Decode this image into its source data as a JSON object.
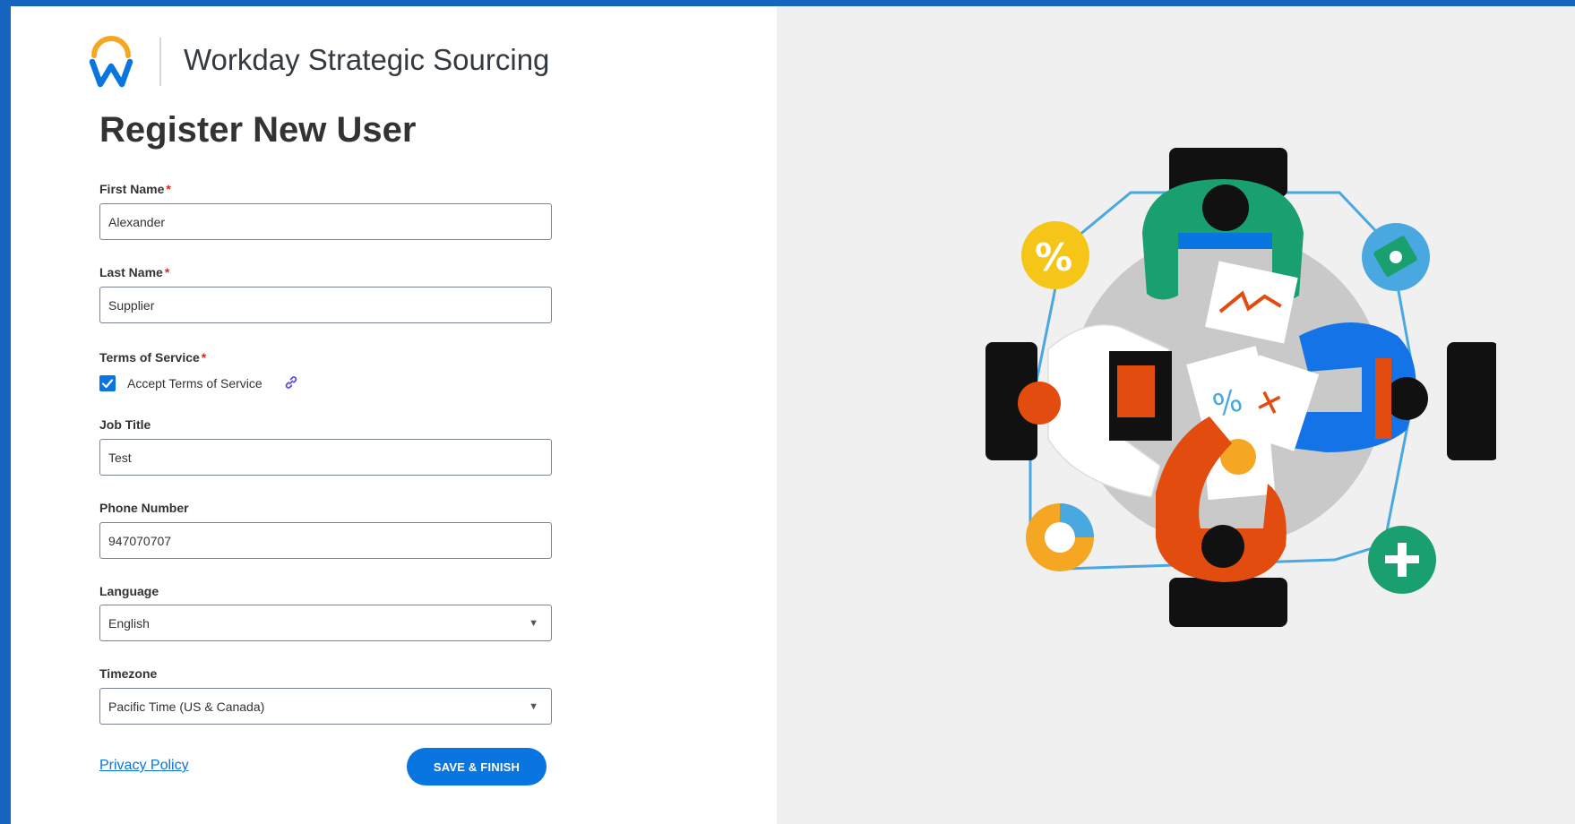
{
  "app": {
    "brand_name": "Workday Strategic Sourcing"
  },
  "page": {
    "title": "Register New User"
  },
  "form": {
    "required_marker": "*",
    "first_name": {
      "label": "First Name",
      "value": "Alexander"
    },
    "last_name": {
      "label": "Last Name",
      "value": "Supplier"
    },
    "terms": {
      "label": "Terms of Service",
      "checkbox_label": "Accept Terms of Service",
      "checked": true
    },
    "job_title": {
      "label": "Job Title",
      "value": "Test"
    },
    "phone": {
      "label": "Phone Number",
      "value": "947070707"
    },
    "language": {
      "label": "Language",
      "value": "English"
    },
    "timezone": {
      "label": "Timezone",
      "value": "Pacific Time (US & Canada)"
    }
  },
  "footer": {
    "privacy_link": "Privacy Policy",
    "save_button": "SAVE & FINISH"
  },
  "icons": {
    "logo": "workday-logo-icon",
    "terms_link": "link-icon",
    "select_caret": "caret-down-icon",
    "checkbox": "checkmark-icon"
  },
  "colors": {
    "accent": "#0875e1",
    "frame": "#1565c0",
    "required": "#de2a1e",
    "right_panel": "#f0f0f0",
    "logo_orange": "#f5a623",
    "logo_blue": "#0875e1"
  }
}
